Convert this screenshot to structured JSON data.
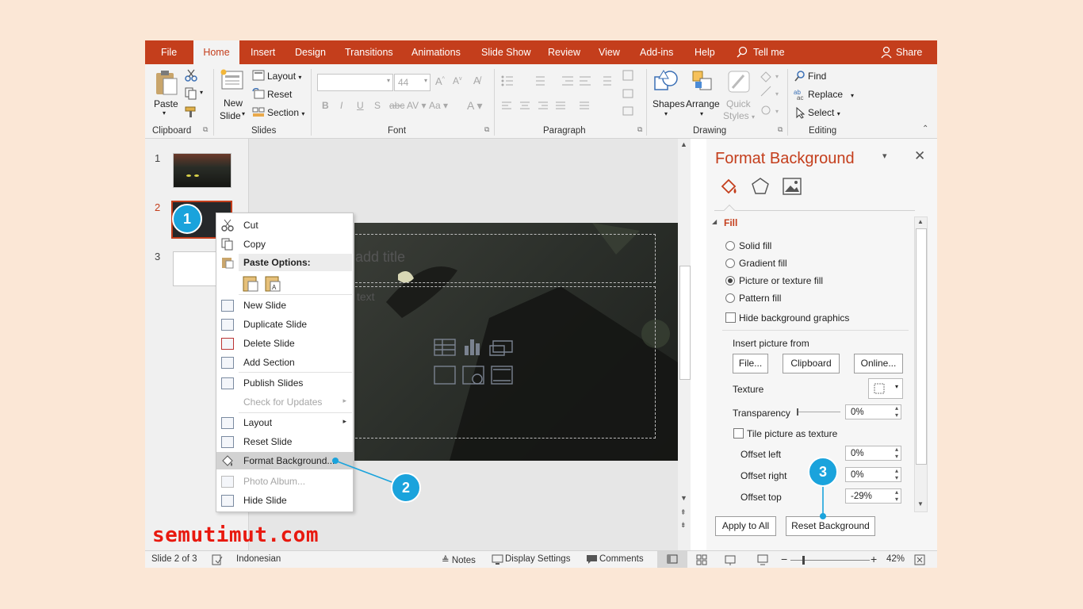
{
  "tabs": [
    "File",
    "Home",
    "Insert",
    "Design",
    "Transitions",
    "Animations",
    "Slide Show",
    "Review",
    "View",
    "Add-ins",
    "Help"
  ],
  "tell_me": "Tell me",
  "share": "Share",
  "ribbon": {
    "paste": "Paste",
    "new_slide_1": "New",
    "new_slide_2": "Slide",
    "layout": "Layout",
    "reset": "Reset",
    "section": "Section",
    "font_size": "44",
    "shapes": "Shapes",
    "arrange": "Arrange",
    "quick_styles_1": "Quick",
    "quick_styles_2": "Styles",
    "find": "Find",
    "replace": "Replace",
    "select": "Select",
    "groups": [
      "Clipboard",
      "Slides",
      "Font",
      "Paragraph",
      "Drawing",
      "Editing"
    ]
  },
  "thumbnails": [
    "1",
    "2",
    "3"
  ],
  "slide": {
    "title_placeholder": "add title",
    "text_placeholder": "text"
  },
  "context_menu": {
    "cut": "Cut",
    "copy": "Copy",
    "paste_options": "Paste Options:",
    "new_slide": "New Slide",
    "duplicate_slide": "Duplicate Slide",
    "delete_slide": "Delete Slide",
    "add_section": "Add Section",
    "publish_slides": "Publish Slides",
    "check_updates": "Check for Updates",
    "layout": "Layout",
    "reset_slide": "Reset Slide",
    "format_background": "Format Background...",
    "photo_album": "Photo Album...",
    "hide_slide": "Hide Slide"
  },
  "pane": {
    "title": "Format Background",
    "fill_header": "Fill",
    "solid": "Solid fill",
    "gradient": "Gradient fill",
    "picture": "Picture or texture fill",
    "pattern": "Pattern fill",
    "hide_bg": "Hide background graphics",
    "insert_from": "Insert picture from",
    "file_btn": "File...",
    "clipboard_btn": "Clipboard",
    "online_btn": "Online...",
    "texture": "Texture",
    "transparency": "Transparency",
    "transparency_val": "0%",
    "tile": "Tile picture as texture",
    "offset_left": "Offset left",
    "offset_left_val": "0%",
    "offset_right": "Offset right",
    "offset_right_val": "0%",
    "offset_top": "Offset top",
    "offset_top_val": "-29%",
    "apply_all": "Apply to All",
    "reset_bg": "Reset Background"
  },
  "status": {
    "slide_info": "Slide 2 of 3",
    "language": "Indonesian",
    "notes": "Notes",
    "display_settings": "Display Settings",
    "comments": "Comments",
    "zoom": "42%"
  },
  "callouts": [
    "1",
    "2",
    "3"
  ],
  "watermark": "semutimut.com",
  "colors": {
    "accent": "#c43e1c",
    "callout": "#1aa3dc",
    "watermark": "#e8190f"
  }
}
